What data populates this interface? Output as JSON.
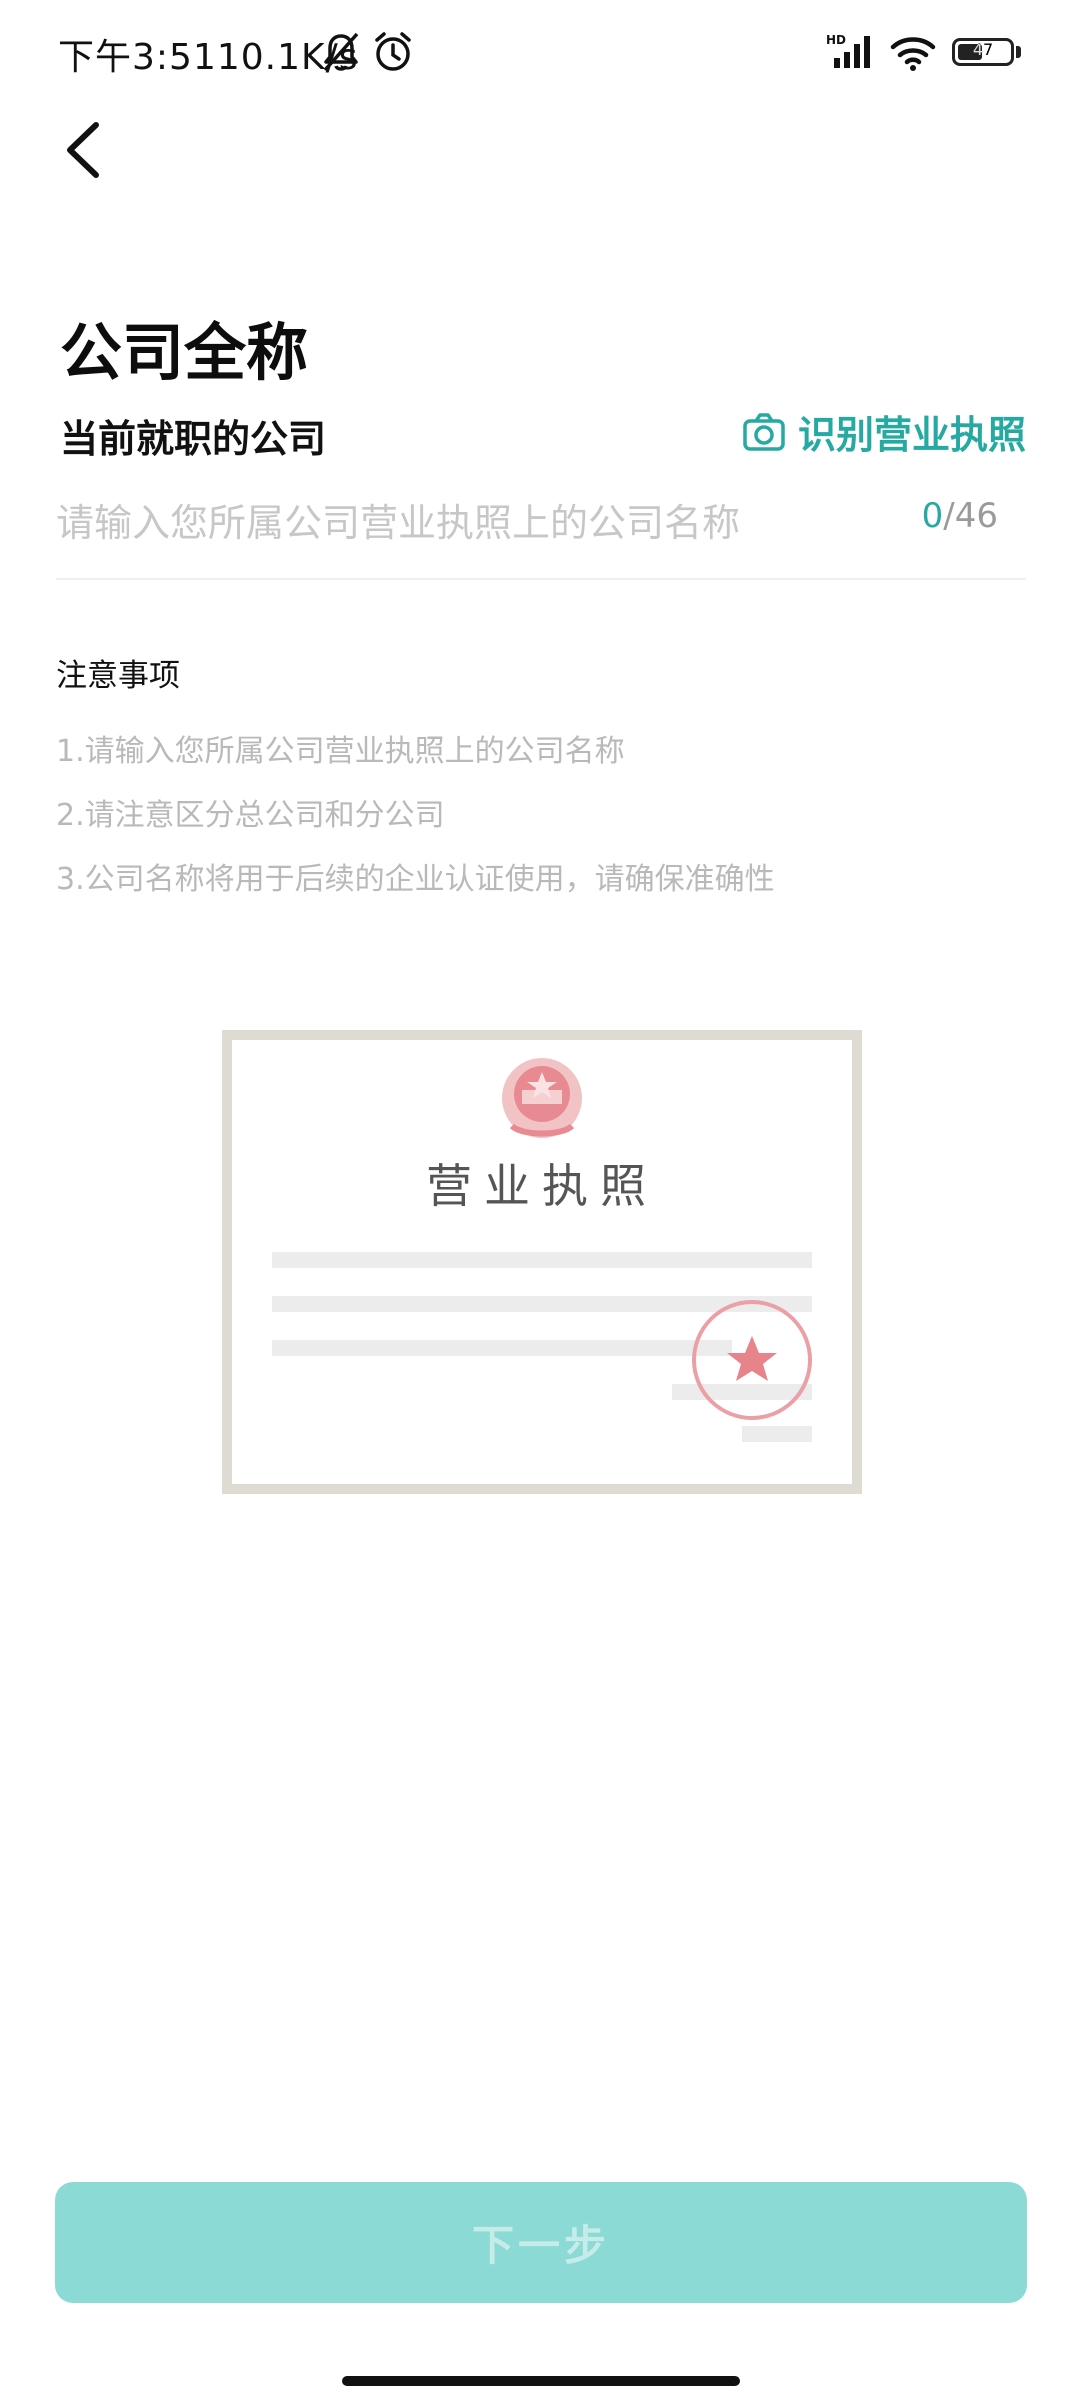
{
  "status_bar": {
    "time": "下午3:51",
    "net_speed": "10.1K/s",
    "battery": "47",
    "battery_level": 0.47,
    "signal_label": "HD",
    "icons": [
      "bell-off-icon",
      "alarm-icon",
      "signal-icon",
      "wifi-icon",
      "battery-icon"
    ]
  },
  "header": {
    "back_icon": "chevron-left-icon"
  },
  "title": "公司全称",
  "subtitle": "当前就职的公司",
  "ocr_link": {
    "icon": "camera-icon",
    "label": "识别营业执照"
  },
  "company_input": {
    "value": "",
    "placeholder": "请输入您所属公司营业执照上的公司名称",
    "count_current": "0",
    "count_max": "/46"
  },
  "notes": {
    "title": "注意事项",
    "items": [
      "1.请输入您所属公司营业执照上的公司名称",
      "2.请注意区分总公司和分公司",
      "3.公司名称将用于后续的企业认证使用，请确保准确性"
    ]
  },
  "license_card": {
    "title": "营业执照"
  },
  "next_button": {
    "label": "下一步",
    "enabled": false
  },
  "colors": {
    "accent": "#26a9a3",
    "button_disabled_bg": "#8bdad5",
    "seal_red": "#e7838b"
  }
}
